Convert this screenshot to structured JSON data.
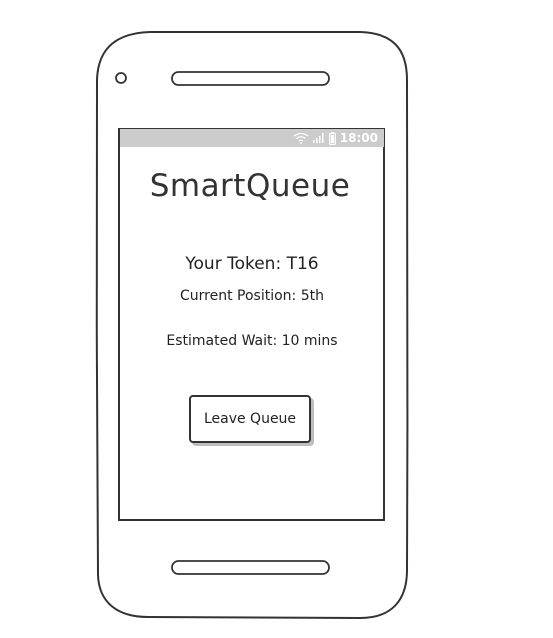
{
  "app": {
    "title": "SmartQueue"
  },
  "status_bar": {
    "time": "18:00",
    "icons": [
      "wifi-icon",
      "signal-icon",
      "battery-icon"
    ]
  },
  "queue": {
    "token_text": "Your Token: T16",
    "position_text": "Current Position: 5th",
    "wait_text": "Estimated Wait: 10 mins"
  },
  "actions": {
    "leave_label": "Leave Queue"
  },
  "colors": {
    "outline": "#333333",
    "status_bar": "#cccccc",
    "background": "#ffffff"
  }
}
